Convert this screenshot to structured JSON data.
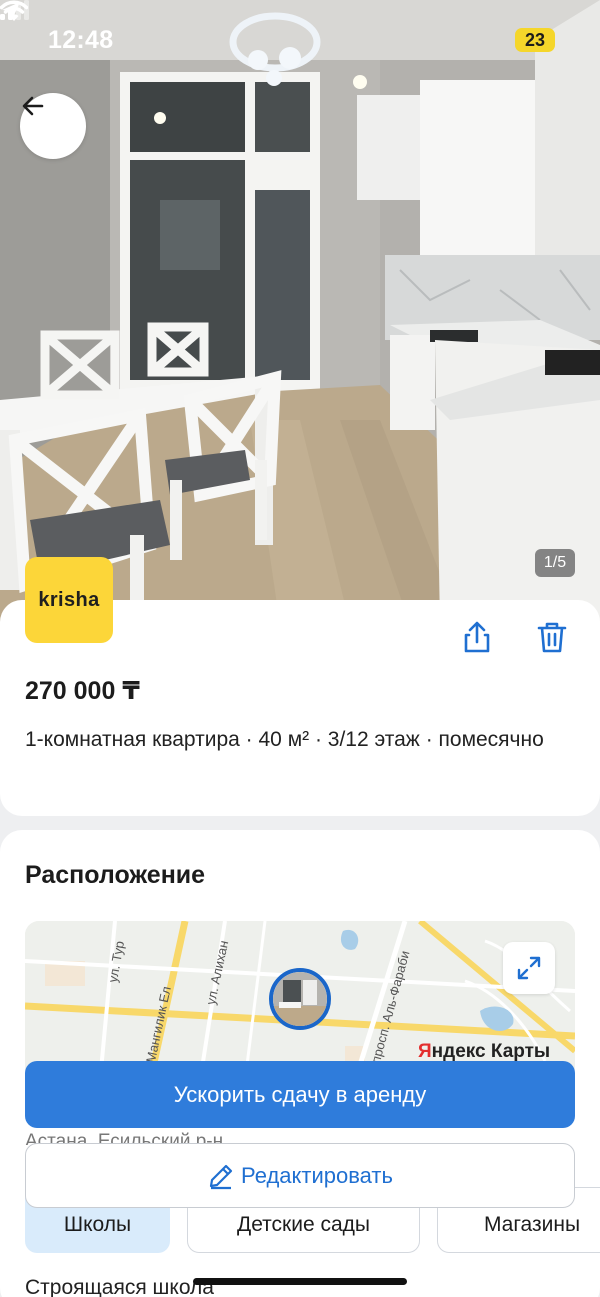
{
  "status_bar": {
    "time": "12:48",
    "battery": "23",
    "icons": [
      "location-arrow-icon",
      "signal-icon",
      "wifi-icon",
      "battery-icon"
    ]
  },
  "gallery": {
    "counter": "1/5",
    "back_icon": "arrow-left-icon"
  },
  "listing": {
    "logo_text": "krisha",
    "price": "270 000 ₸",
    "description": "1-комнатная квартира · 40 м² · 3/12 этаж · помесячно",
    "actions": [
      "share-icon",
      "trash-icon"
    ]
  },
  "location": {
    "title": "Расположение",
    "map_provider": "Яндекс Карты",
    "map_provider_first_letter": "Я",
    "map_provider_rest": "ндекс Карты",
    "streets": [
      "ул. Тур",
      "Мангилик Ел",
      "ул. Алихан",
      "просп. Аль-Фараби"
    ],
    "address_partial": "Астана, Есильский р-н",
    "expand_icon": "expand-icon"
  },
  "buttons": {
    "promote": "Ускорить сдачу в аренду",
    "edit": "Редактировать"
  },
  "nearby": {
    "tabs": [
      "Школы",
      "Детские сады",
      "Магазины"
    ],
    "active_tab": "Школы",
    "first_item": "Строящаяся школа"
  },
  "colors": {
    "accent_blue": "#2f7cdb",
    "krisha_yellow": "#fcd639",
    "active_chip": "#d9ebfb"
  }
}
